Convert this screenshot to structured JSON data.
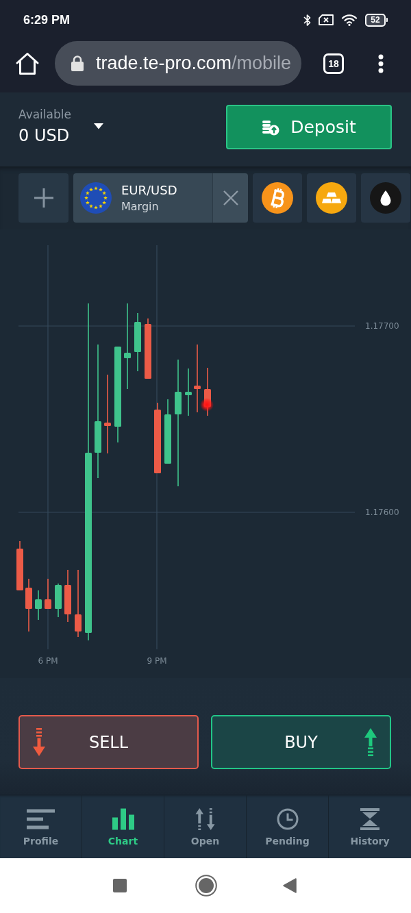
{
  "status_bar": {
    "time": "6:29 PM",
    "battery": "52"
  },
  "browser": {
    "url_host": "trade.te-pro.com",
    "url_path": "/mobile",
    "tab_count": "18"
  },
  "account": {
    "label": "Available",
    "balance": "0 USD",
    "deposit_label": "Deposit"
  },
  "instruments": [
    {
      "kind": "currency",
      "name": "EUR/USD",
      "type": "Margin",
      "selected": true
    },
    {
      "kind": "bitcoin",
      "selected": false
    },
    {
      "kind": "gold",
      "selected": false
    },
    {
      "kind": "oil",
      "selected": false
    }
  ],
  "chart": {
    "price_labels": [
      "1.17700",
      "1.17600"
    ],
    "time_labels": [
      "6 PM",
      "9 PM"
    ]
  },
  "trade_buttons": [
    {
      "kind": "sell",
      "label": "SELL"
    },
    {
      "kind": "buy",
      "label": "BUY"
    }
  ],
  "nav": [
    {
      "label": "Profile",
      "selected": false
    },
    {
      "label": "Chart",
      "selected": true
    },
    {
      "label": "Open",
      "selected": false
    },
    {
      "label": "Pending",
      "selected": false
    },
    {
      "label": "History",
      "selected": false
    }
  ]
}
